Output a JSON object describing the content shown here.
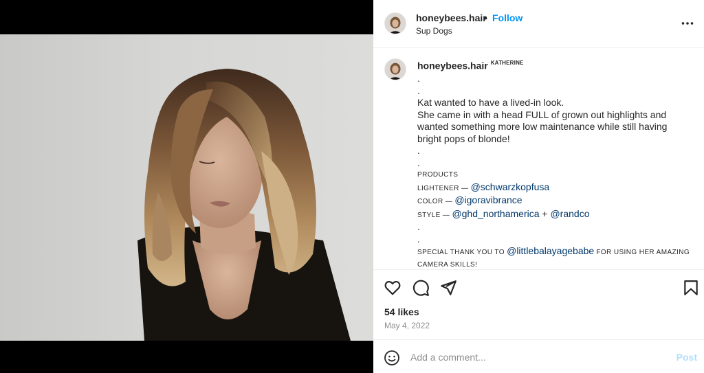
{
  "header": {
    "username": "honeybees.hair",
    "separator": "•",
    "follow_label": "Follow",
    "location": "Sup Dogs",
    "more_icon": "more-horizontal-icon"
  },
  "caption": {
    "username": "honeybees.hair",
    "user_tag": "KATHERINE",
    "lines": {
      "l1": ".",
      "l2": ".",
      "l3": "Kat wanted to have a lived-in look.",
      "l4": "She came in with a head FULL of grown out highlights and",
      "l5": "wanted something more low maintenance while still having",
      "l6": "bright pops of blonde!",
      "l7": ".",
      "l8": ".",
      "products": "PRODUCTS",
      "lightener_label": "LIGHTENER — ",
      "lightener_mention": "@schwarzkopfusa",
      "color_label": "COLOR — ",
      "color_mention": "@igoravibrance",
      "style_label": "STYLE — ",
      "style_mention_1": "@ghd_northamerica",
      "style_join": " + ",
      "style_mention_2": "@randco",
      "l9": ".",
      "l10": ".",
      "thanks_label": "SPECIAL THANK YOU TO ",
      "thanks_mention": "@littlebalayagebabe",
      "thanks_rest": " FOR USING HER AMAZING",
      "thanks_end": "CAMERA SKILLS!"
    }
  },
  "actions": {
    "like_icon": "heart-icon",
    "comment_icon": "comment-icon",
    "share_icon": "send-icon",
    "save_icon": "bookmark-icon"
  },
  "likes": "54 likes",
  "date": "May 4, 2022",
  "comment": {
    "placeholder": "Add a comment...",
    "post_label": "Post",
    "emoji_icon": "emoji-icon"
  },
  "colors": {
    "follow": "#0095f6",
    "mention": "#00376b",
    "post_disabled": "#b2dffc",
    "muted": "#8e8e8e"
  }
}
